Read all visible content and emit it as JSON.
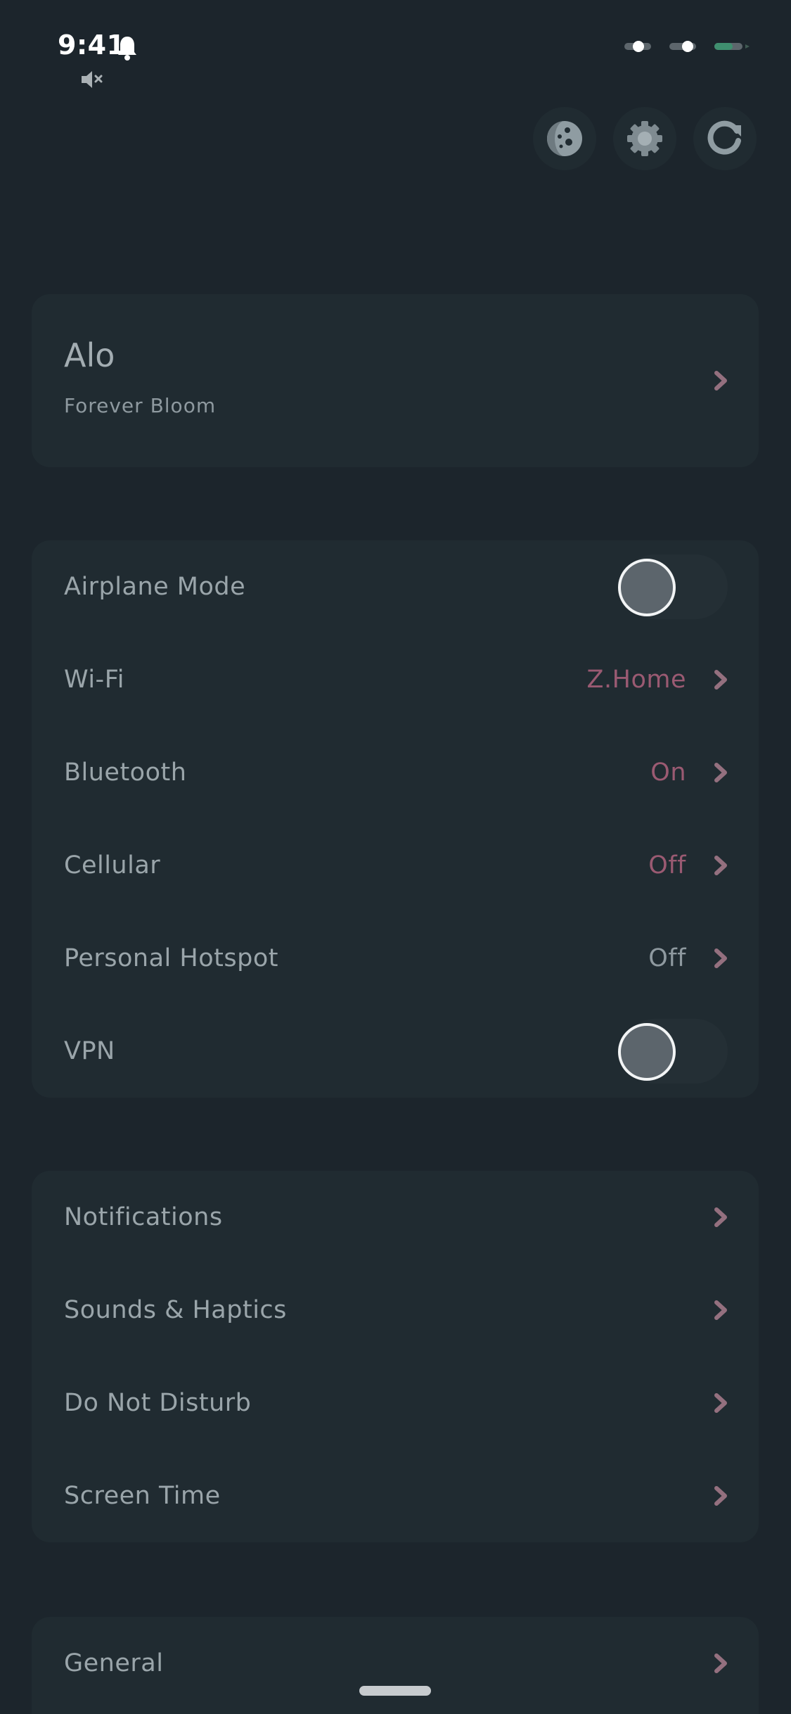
{
  "status_bar": {
    "time": "9:41"
  },
  "top_actions": [
    {
      "icon": "moon-icon"
    },
    {
      "icon": "gear-icon"
    },
    {
      "icon": "refresh-icon"
    }
  ],
  "profile": {
    "name": "Alo",
    "subtitle": "Forever Bloom"
  },
  "connectivity": {
    "airplane_mode": {
      "label": "Airplane Mode",
      "on": false
    },
    "wifi": {
      "label": "Wi-Fi",
      "value": "Z.Home"
    },
    "bluetooth": {
      "label": "Bluetooth",
      "value": "On"
    },
    "cellular": {
      "label": "Cellular",
      "value": "Off"
    },
    "hotspot": {
      "label": "Personal Hotspot",
      "value": "Off"
    },
    "vpn": {
      "label": "VPN",
      "on": false
    }
  },
  "notifications_group": {
    "notifications": "Notifications",
    "sounds": "Sounds & Haptics",
    "dnd": "Do Not Disturb",
    "screen_time": "Screen Time"
  },
  "general_group": {
    "general": "General"
  },
  "colors": {
    "background": "#1c252c",
    "card": "#202b31",
    "accent_value": "#9a5a72",
    "chevron": "#94707f",
    "muted_value": "#8e999f",
    "status_green": "#3f8f6f"
  }
}
